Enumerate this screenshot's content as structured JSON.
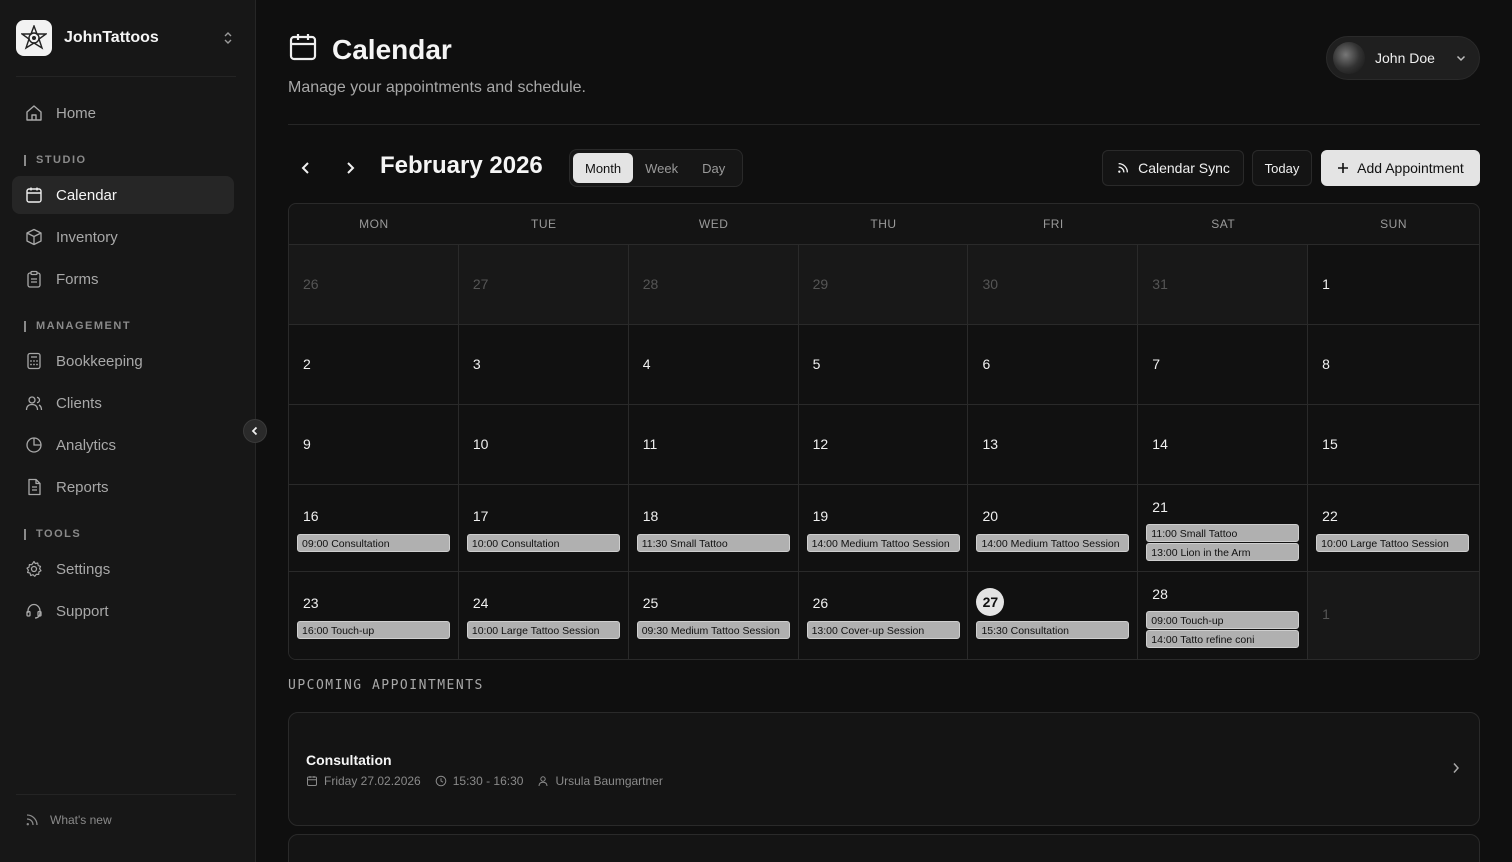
{
  "brand": {
    "name": "JohnTattoos",
    "logo_icon": "tattoo-mandala-logo"
  },
  "sidebar": {
    "home": "Home",
    "section_studio": "STUDIO",
    "calendar": "Calendar",
    "inventory": "Inventory",
    "forms": "Forms",
    "section_management": "MANAGEMENT",
    "bookkeeping": "Bookkeeping",
    "clients": "Clients",
    "analytics": "Analytics",
    "reports": "Reports",
    "section_tools": "TOOLS",
    "settings": "Settings",
    "support": "Support",
    "whats_new": "What's new"
  },
  "header": {
    "title": "Calendar",
    "subtitle": "Manage your appointments and schedule.",
    "user_name": "John Doe"
  },
  "toolbar": {
    "month_title": "February 2026",
    "views": [
      "Month",
      "Week",
      "Day"
    ],
    "active_view": "Month",
    "calendar_sync": "Calendar Sync",
    "today": "Today",
    "add_appointment": "Add Appointment"
  },
  "calendar": {
    "weekdays": [
      "MON",
      "TUE",
      "WED",
      "THU",
      "FRI",
      "SAT",
      "SUN"
    ],
    "today": "27",
    "weeks": [
      {
        "days": [
          {
            "n": "26",
            "other": true,
            "events": []
          },
          {
            "n": "27",
            "other": true,
            "events": []
          },
          {
            "n": "28",
            "other": true,
            "events": []
          },
          {
            "n": "29",
            "other": true,
            "events": []
          },
          {
            "n": "30",
            "other": true,
            "events": []
          },
          {
            "n": "31",
            "other": true,
            "events": []
          },
          {
            "n": "1",
            "other": false,
            "events": []
          }
        ]
      },
      {
        "days": [
          {
            "n": "2",
            "other": false,
            "events": []
          },
          {
            "n": "3",
            "other": false,
            "events": []
          },
          {
            "n": "4",
            "other": false,
            "events": []
          },
          {
            "n": "5",
            "other": false,
            "events": []
          },
          {
            "n": "6",
            "other": false,
            "events": []
          },
          {
            "n": "7",
            "other": false,
            "events": []
          },
          {
            "n": "8",
            "other": false,
            "events": []
          }
        ]
      },
      {
        "days": [
          {
            "n": "9",
            "other": false,
            "events": []
          },
          {
            "n": "10",
            "other": false,
            "events": []
          },
          {
            "n": "11",
            "other": false,
            "events": []
          },
          {
            "n": "12",
            "other": false,
            "events": []
          },
          {
            "n": "13",
            "other": false,
            "events": []
          },
          {
            "n": "14",
            "other": false,
            "events": []
          },
          {
            "n": "15",
            "other": false,
            "events": []
          }
        ]
      },
      {
        "days": [
          {
            "n": "16",
            "other": false,
            "events": [
              "09:00 Consultation"
            ]
          },
          {
            "n": "17",
            "other": false,
            "events": [
              "10:00 Consultation"
            ]
          },
          {
            "n": "18",
            "other": false,
            "events": [
              "11:30 Small Tattoo"
            ]
          },
          {
            "n": "19",
            "other": false,
            "events": [
              "14:00 Medium Tattoo Session"
            ]
          },
          {
            "n": "20",
            "other": false,
            "events": [
              "14:00 Medium Tattoo Session"
            ]
          },
          {
            "n": "21",
            "other": false,
            "events": [
              "11:00 Small Tattoo",
              "13:00 Lion in the Arm"
            ]
          },
          {
            "n": "22",
            "other": false,
            "events": [
              "10:00 Large Tattoo Session"
            ]
          }
        ]
      },
      {
        "days": [
          {
            "n": "23",
            "other": false,
            "events": [
              "16:00 Touch-up"
            ]
          },
          {
            "n": "24",
            "other": false,
            "events": [
              "10:00 Large Tattoo Session"
            ]
          },
          {
            "n": "25",
            "other": false,
            "events": [
              "09:30 Medium Tattoo Session"
            ]
          },
          {
            "n": "26",
            "other": false,
            "events": [
              "13:00 Cover-up Session"
            ]
          },
          {
            "n": "27",
            "other": false,
            "events": [
              "15:30 Consultation"
            ]
          },
          {
            "n": "28",
            "other": false,
            "events": [
              "09:00 Touch-up",
              "14:00 Tatto refine coni"
            ]
          },
          {
            "n": "1",
            "other": true,
            "events": []
          }
        ]
      }
    ]
  },
  "upcoming": {
    "title": "UPCOMING APPOINTMENTS",
    "items": [
      {
        "name": "Consultation",
        "date": "Friday 27.02.2026",
        "time": "15:30 - 16:30",
        "client": "Ursula Baumgartner"
      }
    ]
  },
  "colors": {
    "background": "#0f0f0f",
    "sidebar": "#171717",
    "event": "#b0b0b0",
    "accent_light": "#e4e4e4"
  }
}
